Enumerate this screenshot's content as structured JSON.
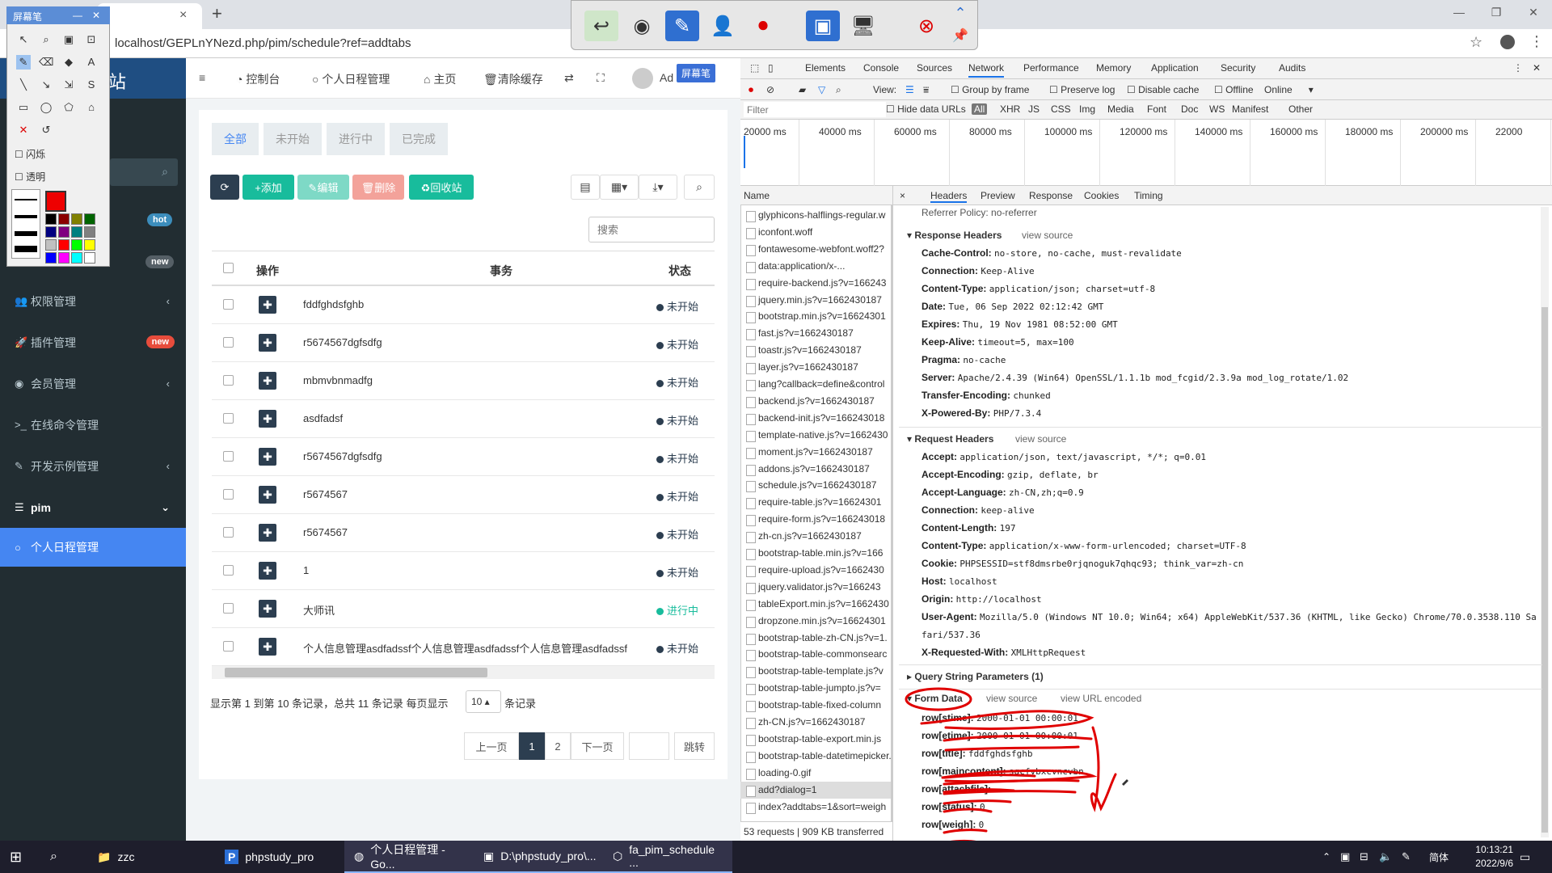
{
  "browser": {
    "tab_close": "×",
    "new_tab": "+",
    "url": "localhost/GEPLnYNezd.php/pim/schedule?ref=addtabs",
    "star": "☆",
    "more": "⋮"
  },
  "window_controls": [
    "—",
    "❐",
    "✕"
  ],
  "screen_pen": {
    "title": "屏幕笔",
    "minimize": "—",
    "close": "✕",
    "option_flash": "闪烁",
    "option_transparent": "透明"
  },
  "sidebar": {
    "logo": "站",
    "badges": {
      "hot": "hot",
      "new": "new",
      "plugin_new": "new"
    },
    "items": [
      {
        "label": "权限管理",
        "icon": "users-icon",
        "glyph": "👥",
        "chev": "‹"
      },
      {
        "label": "插件管理",
        "icon": "rocket-icon",
        "glyph": "🚀",
        "chev": ""
      },
      {
        "label": "会员管理",
        "icon": "user-circle-icon",
        "glyph": "◉",
        "chev": "‹"
      },
      {
        "label": "在线命令管理",
        "icon": "terminal-icon",
        "glyph": ">_",
        "chev": ""
      },
      {
        "label": "开发示例管理",
        "icon": "magic-icon",
        "glyph": "✎",
        "chev": "‹"
      },
      {
        "label": "pim",
        "icon": "list-icon",
        "glyph": "☰",
        "chev": "⌄"
      },
      {
        "label": "个人日程管理",
        "icon": "circle-icon",
        "glyph": "○",
        "chev": ""
      }
    ]
  },
  "topnav": {
    "menu": "≡",
    "items": [
      "控制台",
      "个人日程管理",
      "主页",
      "清除缓存"
    ],
    "user": "Ad",
    "tooltip": "屏幕笔"
  },
  "content": {
    "subtabs": [
      "全部",
      "未开始",
      "进行中",
      "已完成"
    ],
    "buttons": {
      "refresh": "⟳",
      "add": "+添加",
      "edit": "✎编辑",
      "delete": "🗑删除",
      "recycle": "♻回收站"
    },
    "search_placeholder": "搜索",
    "columns": [
      "操作",
      "事务",
      "状态"
    ],
    "rows": [
      {
        "title": "fddfghdsfghb",
        "status": "未开始",
        "color": "#2c3e50"
      },
      {
        "title": "r5674567dgfsdfg",
        "status": "未开始",
        "color": "#2c3e50"
      },
      {
        "title": "mbmvbnmadfg",
        "status": "未开始",
        "color": "#2c3e50"
      },
      {
        "title": "asdfadsf",
        "status": "未开始",
        "color": "#2c3e50"
      },
      {
        "title": "r5674567dgfsdfg",
        "status": "未开始",
        "color": "#2c3e50"
      },
      {
        "title": "r5674567",
        "status": "未开始",
        "color": "#2c3e50"
      },
      {
        "title": "r5674567",
        "status": "未开始",
        "color": "#2c3e50"
      },
      {
        "title": "1",
        "status": "未开始",
        "color": "#2c3e50"
      },
      {
        "title": "大师讯",
        "status": "进行中",
        "color": "#18bc9c"
      },
      {
        "title": "个人信息管理asdfadssf个人信息管理asdfadssf个人信息管理asdfadssf",
        "status": "未开始",
        "color": "#2c3e50"
      }
    ],
    "page_info": "显示第 1 到第 10 条记录，总共 11 条记录 每页显示",
    "page_size": "10 ▴",
    "page_info_after": "条记录",
    "pagination": [
      "上一页",
      "1",
      "2",
      "下一页",
      "",
      "跳转"
    ]
  },
  "devtools": {
    "tabs": [
      "Elements",
      "Console",
      "Sources",
      "Network",
      "Performance",
      "Memory",
      "Application",
      "Security",
      "Audits"
    ],
    "toolbar": {
      "view": "View:",
      "group_by_frame": "Group by frame",
      "preserve_log": "Preserve log",
      "disable_cache": "Disable cache",
      "offline": "Offline",
      "online": "Online"
    },
    "filter": {
      "placeholder": "Filter",
      "hide_data_urls": "Hide data URLs",
      "types": [
        "All",
        "XHR",
        "JS",
        "CSS",
        "Img",
        "Media",
        "Font",
        "Doc",
        "WS",
        "Manifest",
        "Other"
      ]
    },
    "timeline_ticks": [
      "20000 ms",
      "40000 ms",
      "60000 ms",
      "80000 ms",
      "100000 ms",
      "120000 ms",
      "140000 ms",
      "160000 ms",
      "180000 ms",
      "200000 ms",
      "22000"
    ],
    "name_header": "Name",
    "requests": [
      "glyphicons-halflings-regular.w",
      "iconfont.woff",
      "fontawesome-webfont.woff2?",
      "data:application/x-...",
      "require-backend.js?v=166243",
      "jquery.min.js?v=1662430187",
      "bootstrap.min.js?v=16624301",
      "fast.js?v=1662430187",
      "toastr.js?v=1662430187",
      "layer.js?v=1662430187",
      "lang?callback=define&control",
      "backend.js?v=1662430187",
      "backend-init.js?v=166243018",
      "template-native.js?v=1662430",
      "moment.js?v=1662430187",
      "addons.js?v=1662430187",
      "schedule.js?v=1662430187",
      "require-table.js?v=16624301",
      "require-form.js?v=166243018",
      "zh-cn.js?v=1662430187",
      "bootstrap-table.min.js?v=166",
      "require-upload.js?v=1662430",
      "jquery.validator.js?v=166243",
      "tableExport.min.js?v=1662430",
      "dropzone.min.js?v=16624301",
      "bootstrap-table-zh-CN.js?v=1.",
      "bootstrap-table-commonsearc",
      "bootstrap-table-template.js?v",
      "bootstrap-table-jumpto.js?v=",
      "bootstrap-table-fixed-column",
      "zh-CN.js?v=1662430187",
      "bootstrap-table-export.min.js",
      "bootstrap-table-datetimepicker.mi",
      "loading-0.gif",
      "add?dialog=1",
      "index?addtabs=1&sort=weigh"
    ],
    "selected_request": 34,
    "footer": "53 requests | 909 KB transferred",
    "detail_tabs": [
      "×",
      "Headers",
      "Preview",
      "Response",
      "Cookies",
      "Timing"
    ],
    "referrer": "Referrer Policy: no-referrer",
    "response_headers_title": "Response Headers",
    "request_headers_title": "Request Headers",
    "view_source": "view source",
    "view_url_encoded": "view URL encoded",
    "response_headers": [
      {
        "k": "Cache-Control:",
        "v": "no-store, no-cache, must-revalidate"
      },
      {
        "k": "Connection:",
        "v": "Keep-Alive"
      },
      {
        "k": "Content-Type:",
        "v": "application/json; charset=utf-8"
      },
      {
        "k": "Date:",
        "v": "Tue, 06 Sep 2022 02:12:42 GMT"
      },
      {
        "k": "Expires:",
        "v": "Thu, 19 Nov 1981 08:52:00 GMT"
      },
      {
        "k": "Keep-Alive:",
        "v": "timeout=5, max=100"
      },
      {
        "k": "Pragma:",
        "v": "no-cache"
      },
      {
        "k": "Server:",
        "v": "Apache/2.4.39 (Win64) OpenSSL/1.1.1b mod_fcgid/2.3.9a mod_log_rotate/1.02"
      },
      {
        "k": "Transfer-Encoding:",
        "v": "chunked"
      },
      {
        "k": "X-Powered-By:",
        "v": "PHP/7.3.4"
      }
    ],
    "request_headers": [
      {
        "k": "Accept:",
        "v": "application/json, text/javascript, */*; q=0.01"
      },
      {
        "k": "Accept-Encoding:",
        "v": "gzip, deflate, br"
      },
      {
        "k": "Accept-Language:",
        "v": "zh-CN,zh;q=0.9"
      },
      {
        "k": "Connection:",
        "v": "keep-alive"
      },
      {
        "k": "Content-Length:",
        "v": "197"
      },
      {
        "k": "Content-Type:",
        "v": "application/x-www-form-urlencoded; charset=UTF-8"
      },
      {
        "k": "Cookie:",
        "v": "PHPSESSID=stf8dmsrbe0rjqnoguk7qhqc93; think_var=zh-cn"
      },
      {
        "k": "Host:",
        "v": "localhost"
      },
      {
        "k": "Origin:",
        "v": "http://localhost"
      },
      {
        "k": "User-Agent:",
        "v": "Mozilla/5.0 (Windows NT 10.0; Win64; x64) AppleWebKit/537.36 (KHTML, like Gecko) Chrome/70.0.3538.110 Sa"
      },
      {
        "k": "",
        "v": "fari/537.36"
      },
      {
        "k": "X-Requested-With:",
        "v": "XMLHttpRequest"
      }
    ],
    "query_string_title": "Query String Parameters (1)",
    "form_data_title": "Form Data",
    "form_data": [
      {
        "k": "row[stime]:",
        "v": "2000-01-01 00:00:01"
      },
      {
        "k": "row[etime]:",
        "v": "2000-01-01 00:00:01"
      },
      {
        "k": "row[title]:",
        "v": "fddfghdsfghb"
      },
      {
        "k": "row[maincontent]:",
        "v": "sgcfvbxcvncvbn"
      },
      {
        "k": "row[attachfile]:",
        "v": ""
      },
      {
        "k": "row[status]:",
        "v": "0"
      },
      {
        "k": "row[weigh]:",
        "v": "0"
      }
    ]
  },
  "taskbar": {
    "items": [
      "zzc",
      "phpstudy_pro",
      "个人日程管理 - Go...",
      "D:\\phpstudy_pro\\...",
      "fa_pim_schedule ..."
    ],
    "ime": "简体",
    "time": "10:13:21",
    "date": "2022/9/6"
  },
  "colors": {
    "accent": "#4586f2",
    "sidebar": "#222d32",
    "add": "#18bc9c",
    "delete": "#e74c3c",
    "annotation": "#e00000"
  }
}
